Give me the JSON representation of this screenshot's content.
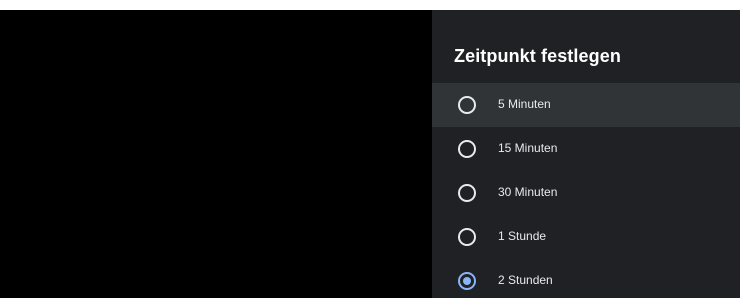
{
  "dialog": {
    "title": "Zeitpunkt festlegen",
    "accent_color": "#8ab4f8",
    "focused_index": 0,
    "selected_index": 4,
    "options": [
      {
        "label": "5 Minuten",
        "checked": false
      },
      {
        "label": "15 Minuten",
        "checked": false
      },
      {
        "label": "30 Minuten",
        "checked": false
      },
      {
        "label": "1 Stunde",
        "checked": false
      },
      {
        "label": "2 Stunden",
        "checked": true
      }
    ]
  }
}
